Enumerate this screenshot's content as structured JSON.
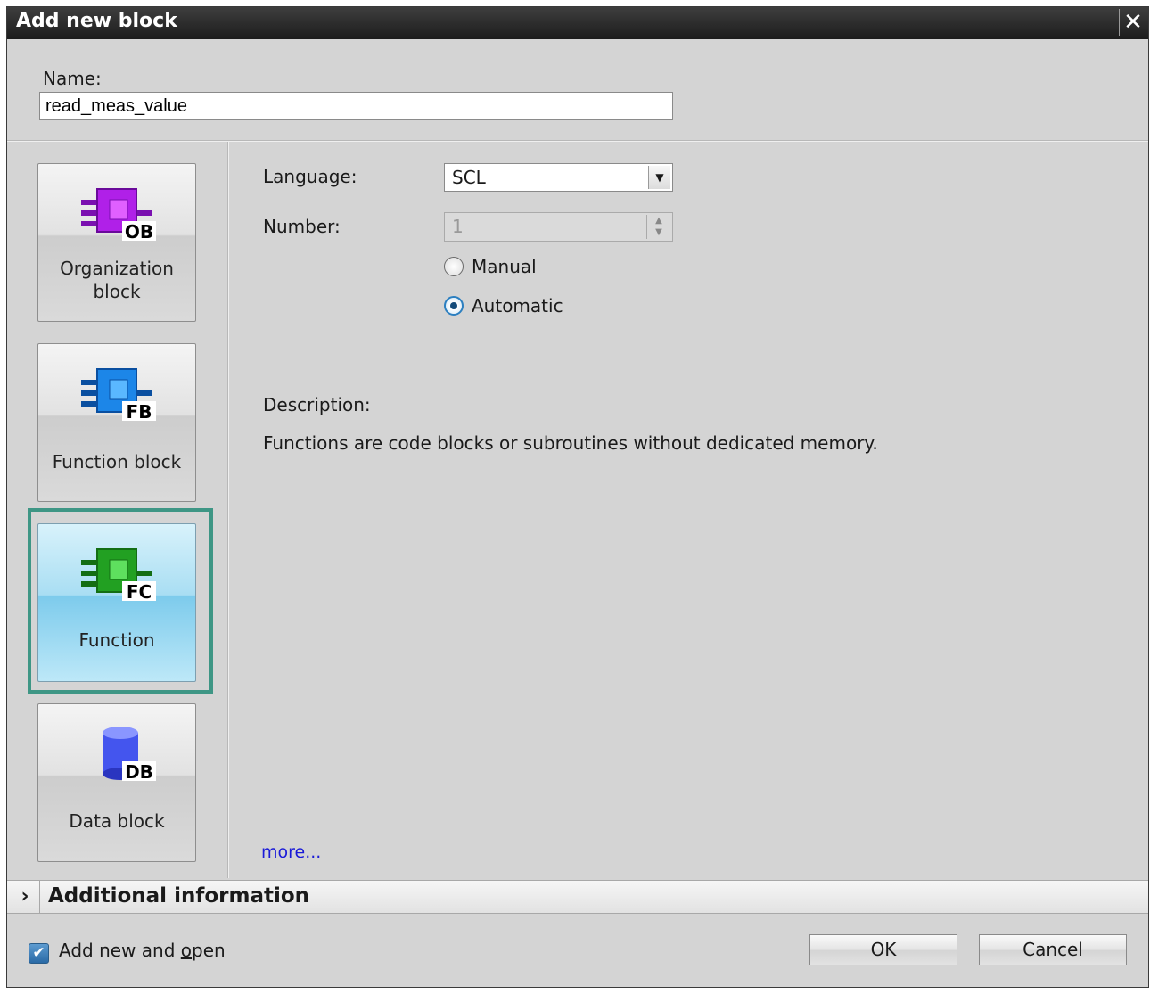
{
  "dialog": {
    "title": "Add new block"
  },
  "name": {
    "label": "Name:",
    "value": "read_meas_value"
  },
  "blocks": [
    {
      "label_line1": "Organization",
      "label_line2": "block",
      "icon": "organization-block-icon",
      "icon_text": "OB",
      "color": "#a020e0"
    },
    {
      "label": "Function block",
      "icon": "function-block-icon",
      "icon_text": "FB",
      "color": "#1a7ee0"
    },
    {
      "label": "Function",
      "icon": "function-icon",
      "icon_text": "FC",
      "color": "#22a022",
      "selected": true
    },
    {
      "label": "Data block",
      "icon": "data-block-icon",
      "icon_text": "DB",
      "color": "#4455ee"
    }
  ],
  "language": {
    "label": "Language:",
    "value": "SCL"
  },
  "number": {
    "label": "Number:",
    "value": "1"
  },
  "numbering": {
    "manual_label": "Manual",
    "automatic_label": "Automatic",
    "selected": "Automatic"
  },
  "description": {
    "label": "Description:",
    "text": "Functions are code blocks or subroutines without dedicated memory."
  },
  "more_link": "more...",
  "additional_info": {
    "label": "Additional information"
  },
  "footer": {
    "add_and_open_prefix": "Add new and ",
    "add_and_open_underlined": "o",
    "add_and_open_suffix": "pen",
    "add_and_open_checked": true,
    "ok_label": "OK",
    "cancel_label": "Cancel"
  },
  "colors": {
    "selection_frame": "#3e9685",
    "link": "#1a1ad8",
    "selected_block": "#7dcbec"
  }
}
